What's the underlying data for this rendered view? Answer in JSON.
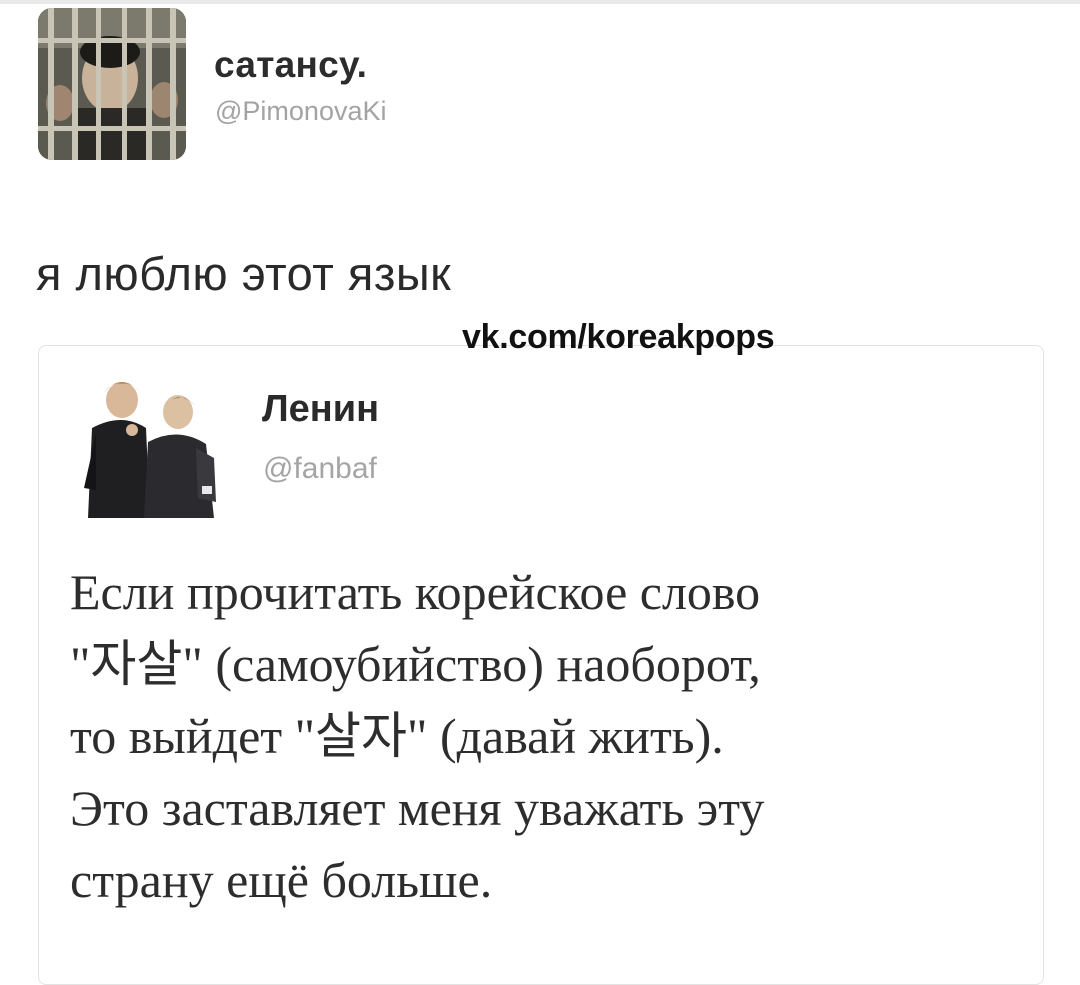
{
  "outer_tweet": {
    "name": "сатансу.",
    "handle": "@PimonovaKi",
    "text": "я люблю этот язык",
    "avatar": "avatar-photo"
  },
  "watermark": "vk.com/koreakpops",
  "quoted_tweet": {
    "name": "Ленин",
    "handle": "@fanbaf",
    "avatar": "avatar-photo",
    "text_lines": [
      "Если прочитать корейское слово",
      "\"자살\" (самоубийство) наоборот,",
      "то выйдет \"살자\" (давай жить).",
      "Это заставляет меня уважать эту",
      "страну ещё больше."
    ]
  }
}
